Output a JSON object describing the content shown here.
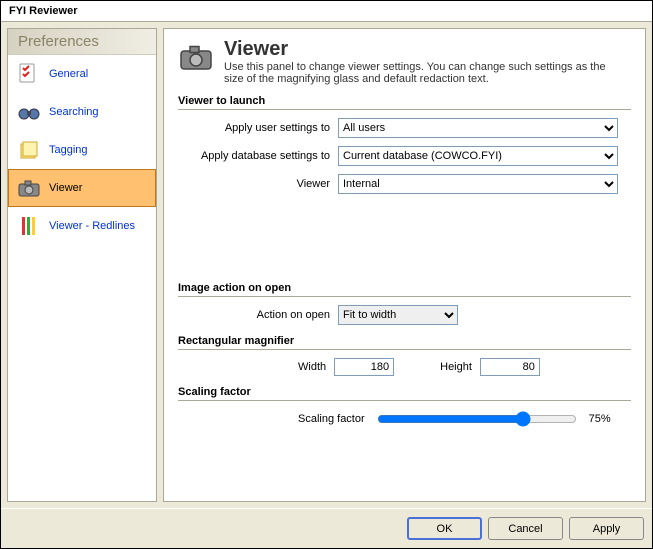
{
  "window": {
    "title": "FYI Reviewer"
  },
  "sidebar": {
    "header": "Preferences",
    "items": [
      {
        "label": "General"
      },
      {
        "label": "Searching"
      },
      {
        "label": "Tagging"
      },
      {
        "label": "Viewer"
      },
      {
        "label": "Viewer - Redlines"
      }
    ]
  },
  "main": {
    "title": "Viewer",
    "description": "Use this panel to change viewer settings. You can change such settings as the size of the magnifying glass and default redaction text.",
    "sections": {
      "launch": {
        "heading": "Viewer to launch",
        "user_label": "Apply user settings to",
        "user_value": "All users",
        "db_label": "Apply database settings to",
        "db_value": "Current database (COWCO.FYI)",
        "viewer_label": "Viewer",
        "viewer_value": "Internal"
      },
      "image_action": {
        "heading": "Image action on open",
        "label": "Action on open",
        "value": "Fit to width"
      },
      "magnifier": {
        "heading": "Rectangular magnifier",
        "width_label": "Width",
        "width_value": "180",
        "height_label": "Height",
        "height_value": "80"
      },
      "scaling": {
        "heading": "Scaling factor",
        "label": "Scaling factor",
        "value": 75,
        "display": "75%"
      }
    }
  },
  "footer": {
    "ok": "OK",
    "cancel": "Cancel",
    "apply": "Apply"
  }
}
